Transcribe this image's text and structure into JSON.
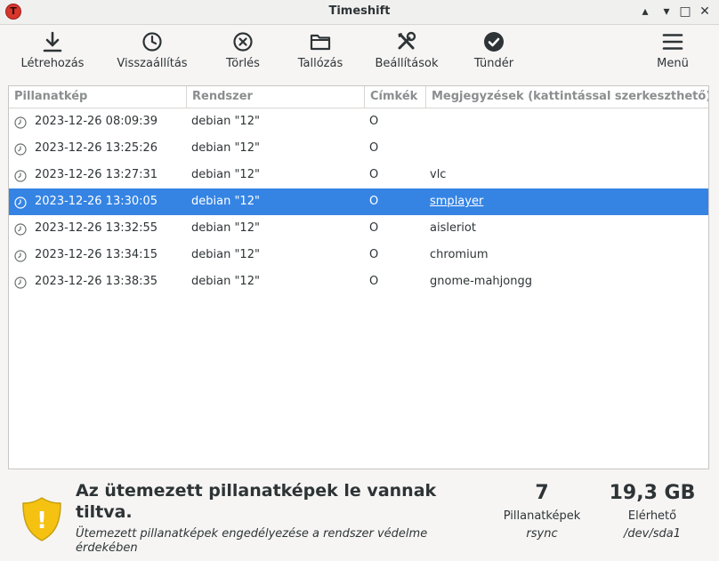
{
  "window": {
    "title": "Timeshift",
    "minimize_glyph": "▴",
    "maximize_glyph": "▾",
    "restore_glyph": "□",
    "close_glyph": "✕",
    "app_icon_glyph": "T"
  },
  "toolbar": {
    "create_label": "Létrehozás",
    "restore_label": "Visszaállítás",
    "delete_label": "Törlés",
    "browse_label": "Tallózás",
    "settings_label": "Beállítások",
    "wizard_label": "Tündér",
    "menu_label": "Menü"
  },
  "table": {
    "headers": [
      "Pillanatkép",
      "Rendszer",
      "Címkék",
      "Megjegyzések (kattintással szerkeszthető)"
    ],
    "selected_index": 3,
    "rows": [
      {
        "snapshot": "2023-12-26 08:09:39",
        "system": "debian \"12\"",
        "tags": "O",
        "comment": ""
      },
      {
        "snapshot": "2023-12-26 13:25:26",
        "system": "debian \"12\"",
        "tags": "O",
        "comment": ""
      },
      {
        "snapshot": "2023-12-26 13:27:31",
        "system": "debian \"12\"",
        "tags": "O",
        "comment": "vlc"
      },
      {
        "snapshot": "2023-12-26 13:30:05",
        "system": "debian \"12\"",
        "tags": "O",
        "comment": "smplayer"
      },
      {
        "snapshot": "2023-12-26 13:32:55",
        "system": "debian \"12\"",
        "tags": "O",
        "comment": "aisleriot"
      },
      {
        "snapshot": "2023-12-26 13:34:15",
        "system": "debian \"12\"",
        "tags": "O",
        "comment": "chromium"
      },
      {
        "snapshot": "2023-12-26 13:38:35",
        "system": "debian \"12\"",
        "tags": "O",
        "comment": "gnome-mahjongg"
      }
    ]
  },
  "status": {
    "title": "Az ütemezett pillanatképek le vannak tiltva.",
    "subtitle": "Ütemezett pillanatképek engedélyezése a rendszer védelme érdekében",
    "shield_glyph": "!",
    "snapshot_count": "7",
    "snapshot_count_label": "Pillanatképek",
    "mode": "rsync",
    "available": "19,3 GB",
    "available_label": "Elérhető",
    "device": "/dev/sda1"
  },
  "colors": {
    "accent": "#3584e4",
    "shield": "#f5c211",
    "app_icon": "#d7362d"
  }
}
